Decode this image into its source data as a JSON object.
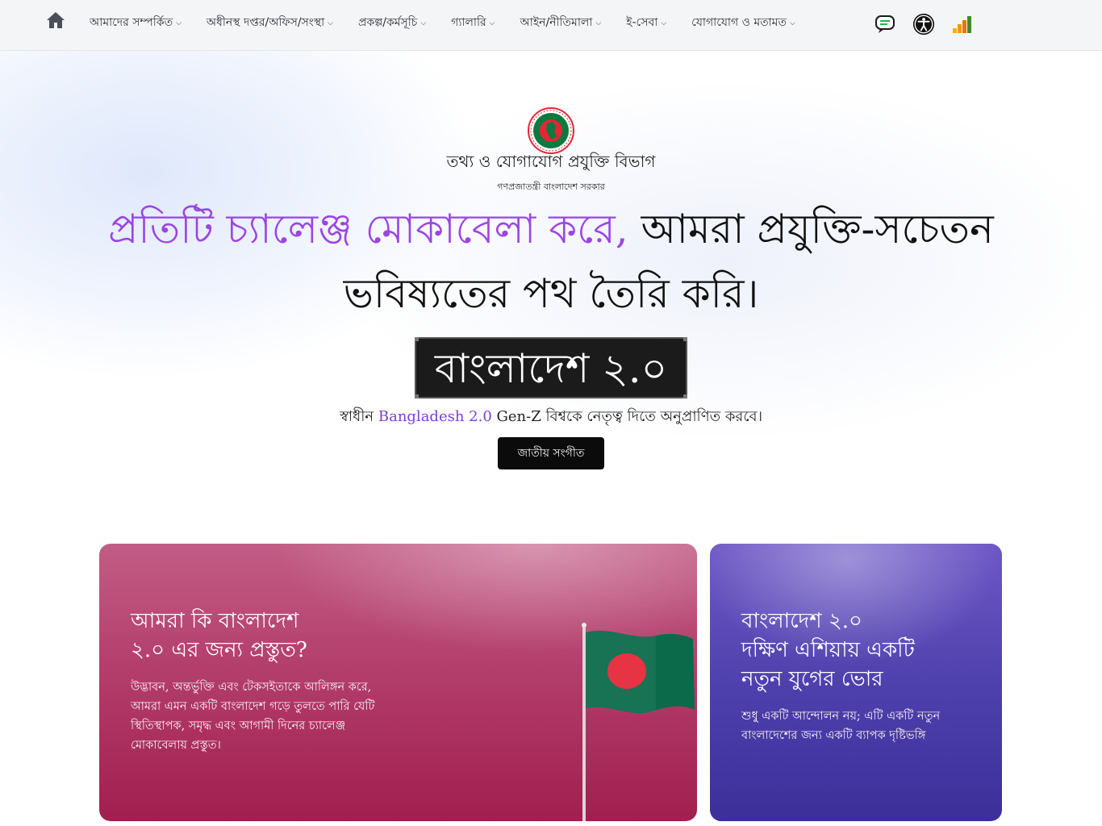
{
  "nav": {
    "home_icon": "home-icon",
    "items": [
      {
        "label": "আমাদের সম্পর্কিত"
      },
      {
        "label": "অধীনস্থ দপ্তর/অফিস/সংস্থা"
      },
      {
        "label": "প্রকল্প/কর্মসূচি"
      },
      {
        "label": "গ্যালারি"
      },
      {
        "label": "আইন/নীতিমালা"
      },
      {
        "label": "ই-সেবা"
      },
      {
        "label": "যোগাযোগ ও মতামত"
      }
    ],
    "icons": [
      "chat-icon",
      "accessibility-icon",
      "signal-bars-icon"
    ]
  },
  "hero": {
    "org_name": "তথ্য ও যোগাযোগ প্রযুক্তি বিভাগ",
    "org_sub": "গণপ্রজাতন্ত্রী বাংলাদেশ সরকার",
    "headline_accent": "প্রতিটি চ্যালেঞ্জ মোকাবেলা করে,",
    "headline_rest": " আমরা প্রযুক্তি-সচেতন ভবিষ্যতের পথ তৈরি করি।",
    "badge": "বাংলাদেশ ২.০",
    "tagline_before": "স্বাধীন ",
    "tagline_accent": "Bangladesh 2.0",
    "tagline_after": " Gen-Z বিশ্বকে নেতৃত্ব দিতে অনুপ্রাণিত করবে।",
    "anthem_button": "জাতীয় সংগীত"
  },
  "cards": {
    "left": {
      "title_line1": "আমরা কি বাংলাদেশ",
      "title_line2": "২.০ এর জন্য প্রস্তুত?",
      "text_line1": "উদ্ভাবন, অন্তর্ভুক্তি এবং টেকসইতাকে আলিঙ্গন করে,",
      "text_line2": "আমরা এমন একটি বাংলাদেশ গড়ে তুলতে পারি যেটি",
      "text_line3": "স্থিতিস্থাপক, সমৃদ্ধ এবং আগামী দিনের চ্যালেঞ্জ",
      "text_line4": "মোকাবেলায় প্রস্তুত।"
    },
    "right": {
      "title_line1": "বাংলাদেশ ২.০",
      "title_line2": "দক্ষিণ এশিয়ায় একটি",
      "title_line3": "নতুন যুগের ভোর",
      "text_line1": "শুধু একটি আন্দোলন নয়; এটি একটি নতুন",
      "text_line2": "বাংলাদেশের জন্য একটি ব্যাপক দৃষ্টিভঙ্গি"
    }
  },
  "colors": {
    "accent_purple": "#9b45e4",
    "card_left": "#b33e6c",
    "card_right": "#4f41ad",
    "flag_green": "#0a6a4a",
    "flag_red": "#e5283a"
  }
}
